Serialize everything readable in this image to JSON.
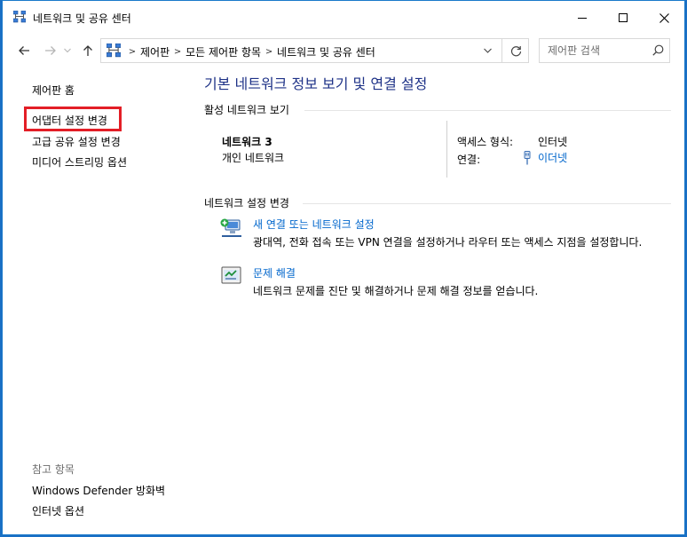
{
  "window": {
    "title": "네트워크 및 공유 센터",
    "icon": "network-icon"
  },
  "navigation": {
    "back_icon": "arrow-left-icon",
    "forward_icon": "arrow-right-icon",
    "recent_icon": "chevron-down-icon",
    "up_icon": "arrow-up-icon"
  },
  "address": {
    "crumbs": [
      "제어판",
      "모든 제어판 항목",
      "네트워크 및 공유 센터"
    ],
    "separator": ">",
    "refresh_icon": "refresh-icon"
  },
  "search": {
    "placeholder": "제어판 검색",
    "icon": "search-icon"
  },
  "sidebar": {
    "home": "제어판 홈",
    "items": [
      "어댑터 설정 변경",
      "고급 공유 설정 변경",
      "미디어 스트리밍 옵션"
    ],
    "highlight_color": "#e31e26",
    "see_also_label": "참고 항목",
    "see_also": [
      "Windows Defender 방화벽",
      "인터넷 옵션"
    ]
  },
  "main": {
    "title": "기본 네트워크 정보 보기 및 연결 설정",
    "active_section": "활성 네트워크 보기",
    "network": {
      "name": "네트워크  3",
      "type": "개인 네트워크",
      "access_label": "액세스 형식:",
      "access_value": "인터넷",
      "connections_label": "연결:",
      "connections_value": "이더넷"
    },
    "change_section": "네트워크 설정 변경",
    "tasks": [
      {
        "title": "새 연결 또는 네트워크 설정",
        "desc": "광대역, 전화 접속 또는 VPN 연결을 설정하거나 라우터 또는 액세스 지점을 설정합니다.",
        "icon": "new-connection-icon"
      },
      {
        "title": "문제 해결",
        "desc": "네트워크 문제를 진단 및 해결하거나 문제 해결 정보를 얻습니다.",
        "icon": "troubleshoot-icon"
      }
    ]
  },
  "colors": {
    "link": "#0066cc",
    "title": "#1e3287",
    "frame": "#1979ca"
  }
}
